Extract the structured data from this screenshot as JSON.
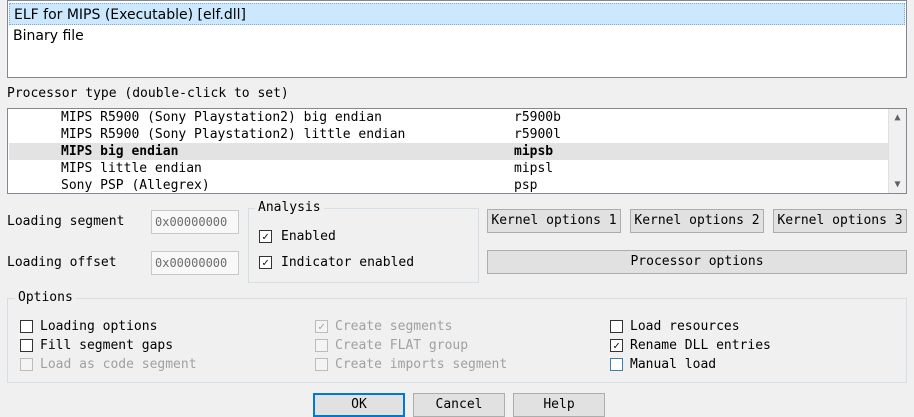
{
  "file_types": [
    {
      "label": "ELF for MIPS (Executable) [elf.dll]",
      "selected": true
    },
    {
      "label": "Binary file",
      "selected": false
    }
  ],
  "processor": {
    "label": "Processor type (double-click to set)",
    "rows": [
      {
        "name": "MIPS R5900 (Sony Playstation2) big endian",
        "code": "r5900b"
      },
      {
        "name": "MIPS R5900 (Sony Playstation2) little endian",
        "code": "r5900l"
      },
      {
        "name": "MIPS big endian",
        "code": "mipsb",
        "selected": true
      },
      {
        "name": "MIPS little endian",
        "code": "mipsl"
      },
      {
        "name": "Sony PSP (Allegrex)",
        "code": "psp"
      }
    ]
  },
  "loading": {
    "segment_label": "Loading segment",
    "segment_value": "0x00000000",
    "offset_label": "Loading offset",
    "offset_value": "0x00000000"
  },
  "analysis": {
    "title": "Analysis",
    "enabled_label": "Enabled",
    "indicator_label": "Indicator enabled"
  },
  "kernel": {
    "btn1": "Kernel options 1",
    "btn2": "Kernel options 2",
    "btn3": "Kernel options 3",
    "processor_options": "Processor options"
  },
  "options": {
    "title": "Options",
    "loading_options": "Loading options",
    "fill_segment_gaps": "Fill segment gaps",
    "load_as_code_segment": "Load as code segment",
    "create_segments": "Create segments",
    "create_flat_group": "Create FLAT group",
    "create_imports_segment": "Create imports segment",
    "load_resources": "Load resources",
    "rename_dll_entries": "Rename DLL entries",
    "manual_load": "Manual load"
  },
  "buttons": {
    "ok": "OK",
    "cancel": "Cancel",
    "help": "Help"
  },
  "colors": {
    "selection": "#cce8ff",
    "default_button_border": "#0078d7"
  },
  "icons": {
    "scroll_up": "chevron-up-icon",
    "scroll_down": "chevron-down-icon",
    "check": "checkmark-icon"
  }
}
